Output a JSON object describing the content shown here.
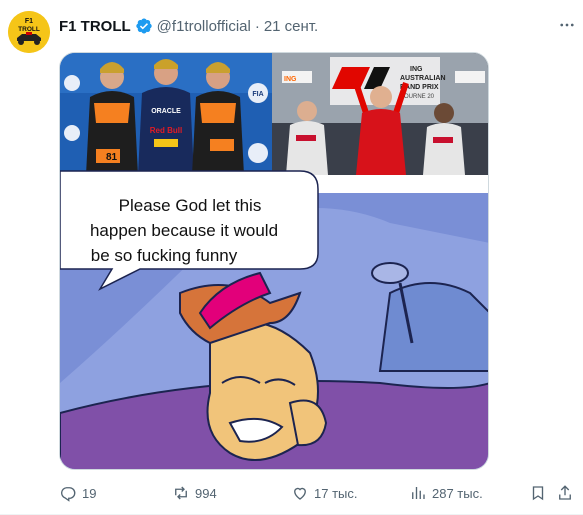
{
  "author": {
    "display_name": "F1 TROLL",
    "handle": "@f1trollofficial",
    "separator": "·",
    "timestamp": "21 сент.",
    "avatar_text_top": "F1",
    "avatar_text_bottom": "TROLL"
  },
  "media": {
    "speech_bubble": {
      "line1": "Please God let this",
      "line2": "happen because it would",
      "line3": "be so fucking funny"
    },
    "podium_left": {
      "badge_fia": "FIA",
      "sponsor_text": "ORACLE",
      "sponsor_text2": "Red Bull",
      "car_number": "81"
    },
    "podium_right": {
      "sign_line1": "ING",
      "sign_line2": "AUSTRALIAN",
      "sign_line3": "RAND PRIX",
      "sign_line4": "BOURNE 20",
      "side_sign": "ING"
    }
  },
  "actions": {
    "replies": "19",
    "reposts": "994",
    "likes": "17 тыс.",
    "views": "287 тыс."
  },
  "colors": {
    "text_primary": "#0f1419",
    "text_secondary": "#536471",
    "verified": "#1d9bf0",
    "border": "#cfd9de"
  }
}
